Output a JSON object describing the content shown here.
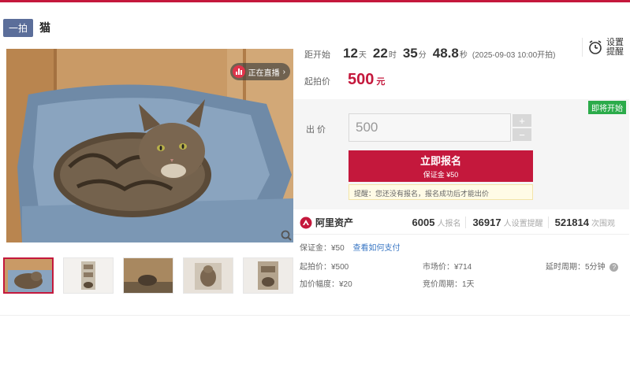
{
  "header": {
    "badge": "一拍",
    "title": "猫"
  },
  "gallery": {
    "live_label": "正在直播",
    "live_arrow": "›",
    "thumbnail_count": 5
  },
  "countdown": {
    "label": "距开始",
    "days": "12",
    "days_unit": "天",
    "hours": "22",
    "hours_unit": "时",
    "minutes": "35",
    "minutes_unit": "分",
    "seconds": "48.8",
    "seconds_unit": "秒",
    "start_note": "(2025-09-03 10:00开拍)"
  },
  "remind": {
    "label": "设置提醒"
  },
  "price": {
    "label": "起拍价",
    "value": "500",
    "unit": "元"
  },
  "bid": {
    "status_badge": "即将开始",
    "label": "出 价",
    "input_value": "500",
    "plus": "+",
    "minus": "−",
    "signup_main": "立即报名",
    "signup_sub": "保证金 ¥50",
    "tip": "提醒：您还没有报名，报名成功后才能出价"
  },
  "platform": {
    "name": "阿里资产",
    "stats": [
      {
        "value": "6005",
        "label": "人报名"
      },
      {
        "value": "36917",
        "label": "人设置提醒"
      },
      {
        "value": "521814",
        "label": "次围观"
      }
    ]
  },
  "details": {
    "deposit": "保证金：¥50",
    "deposit_link": "查看如何支付",
    "start_price": "起拍价：¥500",
    "increment": "加价幅度：¥20",
    "market_price": "市场价：¥714",
    "cycle": "竞价周期：1天",
    "delay": "延时周期：5分钟",
    "help": "?"
  }
}
